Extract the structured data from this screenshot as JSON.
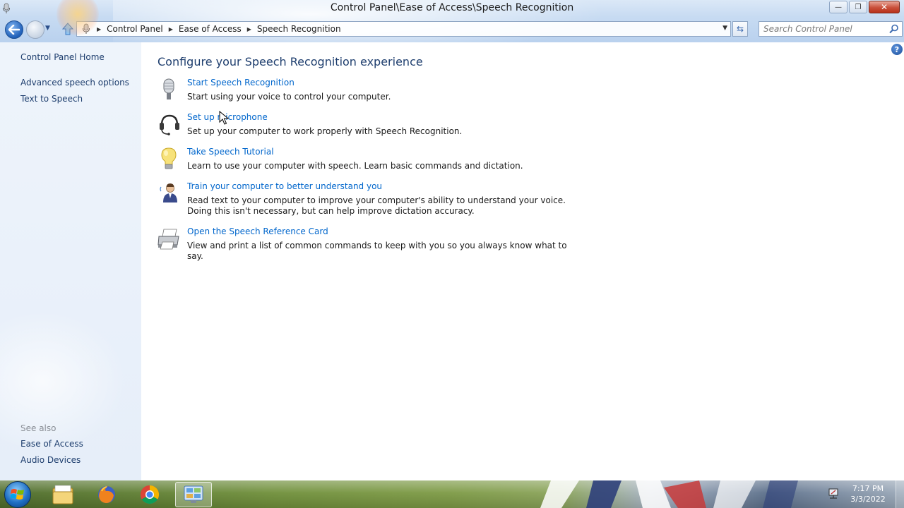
{
  "window": {
    "title": "Control Panel\\Ease of Access\\Speech Recognition"
  },
  "address_bar": {
    "breadcrumbs": [
      "Control Panel",
      "Ease of Access",
      "Speech Recognition"
    ]
  },
  "search": {
    "placeholder": "Search Control Panel"
  },
  "left_pane": {
    "links": [
      "Control Panel Home",
      "Advanced speech options",
      "Text to Speech"
    ],
    "see_also_label": "See also",
    "see_also_links": [
      "Ease of Access",
      "Audio Devices"
    ]
  },
  "main": {
    "heading": "Configure your Speech Recognition experience",
    "tasks": [
      {
        "link": "Start Speech Recognition",
        "description": "Start using your voice to control your computer.",
        "icon": "microphone-icon"
      },
      {
        "link": "Set up microphone",
        "description": "Set up your computer to work properly with Speech Recognition.",
        "icon": "headset-icon"
      },
      {
        "link": "Take Speech Tutorial",
        "description": "Learn to use your computer with speech.  Learn basic commands and dictation.",
        "icon": "lightbulb-icon"
      },
      {
        "link": "Train your computer to better understand you",
        "description": "Read text to your computer to improve your computer's ability to understand your voice.  Doing this isn't necessary, but can help improve dictation accuracy.",
        "icon": "user-speaking-icon"
      },
      {
        "link": "Open the Speech Reference Card",
        "description": "View and print a list of common commands to keep with you so you always know what to say.",
        "icon": "printer-icon"
      }
    ]
  },
  "taskbar": {
    "apps": [
      "file-explorer-icon",
      "firefox-icon",
      "chrome-icon",
      "control-panel-icon"
    ],
    "active_app": "control-panel-icon",
    "clock_time": "7:17 PM",
    "clock_date": "3/3/2022"
  },
  "colors": {
    "link": "#0066cc",
    "heading": "#1e3e6e",
    "left_pane_bg": "#eef4fb"
  }
}
